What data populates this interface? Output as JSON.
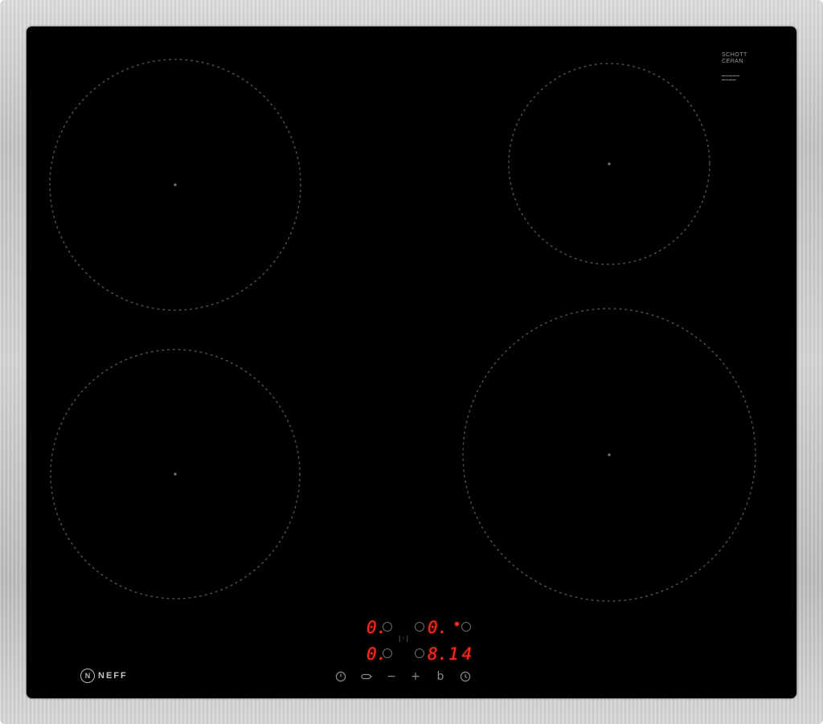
{
  "hob": {
    "brand": "NEFF",
    "brand_mark": "N",
    "glass_brand_line1": "SCHOTT",
    "glass_brand_line2": "CERAN"
  },
  "display": {
    "front_left_level": "0.",
    "rear_left_level": "0.",
    "front_right_level": "0.",
    "timer_zone_level": "8.",
    "timer_minutes": "14"
  },
  "controls": {
    "power_icon": "power-icon",
    "power_boost_icon": "power-boost-icon",
    "minus_symbol": "−",
    "plus_symbol": "+",
    "childlock_symbol": "b",
    "timer_icon": "clock-icon"
  },
  "colors": {
    "glass": "#000000",
    "frame": "#c8c8c8",
    "display_red": "#ff2a1e",
    "zone_outline": "#4a4a4a"
  }
}
